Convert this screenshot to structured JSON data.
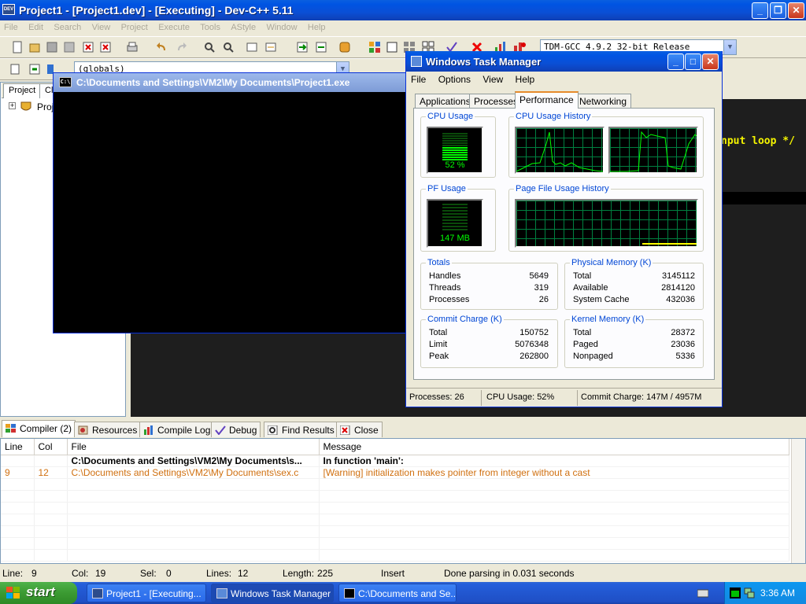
{
  "devcpp": {
    "title": "Project1 - [Project1.dev] - [Executing] - Dev-C++ 5.11",
    "menu": [
      "File",
      "Edit",
      "Search",
      "View",
      "Project",
      "Execute",
      "Tools",
      "AStyle",
      "Window",
      "Help"
    ],
    "compiler_combo": "TDM-GCC 4.9.2 32-bit Release",
    "globals_combo": "(globals)",
    "left_tabs": [
      "Project",
      "Cla"
    ],
    "tree_item": "Proj",
    "code_visible": "nput loop */",
    "bottom_tabs": [
      "Compiler (2)",
      "Resources",
      "Compile Log",
      "Debug",
      "Find Results",
      "Close"
    ],
    "messages": {
      "columns": [
        "Line",
        "Col",
        "File",
        "Message"
      ],
      "rows": [
        {
          "line": "",
          "col": "",
          "file": "C:\\Documents and Settings\\VM2\\My Documents\\s...",
          "message": "In function 'main':",
          "style": "bold"
        },
        {
          "line": "9",
          "col": "12",
          "file": "C:\\Documents and Settings\\VM2\\My Documents\\sex.c",
          "message": "[Warning] initialization makes pointer from integer without a cast",
          "style": "warn"
        }
      ]
    },
    "status": {
      "line_label": "Line:",
      "line": "9",
      "col_label": "Col:",
      "col": "19",
      "sel_label": "Sel:",
      "sel": "0",
      "lines_label": "Lines:",
      "lines": "12",
      "length_label": "Length:",
      "length": "225",
      "mode": "Insert",
      "message": "Done parsing in 0.031 seconds"
    }
  },
  "console": {
    "title": "C:\\Documents and Settings\\VM2\\My Documents\\Project1.exe",
    "icon_text": "C:\\"
  },
  "taskmgr": {
    "title": "Windows Task Manager",
    "menu": [
      "File",
      "Options",
      "View",
      "Help"
    ],
    "tabs": [
      "Applications",
      "Processes",
      "Performance",
      "Networking"
    ],
    "active_tab": "Performance",
    "cpu_usage_label": "CPU Usage",
    "cpu_usage_value": "52 %",
    "cpu_usage_fraction": 0.52,
    "cpu_history_label": "CPU Usage History",
    "pf_usage_label": "PF Usage",
    "pf_usage_value": "147 MB",
    "pf_history_label": "Page File Usage History",
    "totals": {
      "label": "Totals",
      "rows": [
        {
          "k": "Handles",
          "v": "5649"
        },
        {
          "k": "Threads",
          "v": "319"
        },
        {
          "k": "Processes",
          "v": "26"
        }
      ]
    },
    "physical": {
      "label": "Physical Memory (K)",
      "rows": [
        {
          "k": "Total",
          "v": "3145112"
        },
        {
          "k": "Available",
          "v": "2814120"
        },
        {
          "k": "System Cache",
          "v": "432036"
        }
      ]
    },
    "commit": {
      "label": "Commit Charge (K)",
      "rows": [
        {
          "k": "Total",
          "v": "150752"
        },
        {
          "k": "Limit",
          "v": "5076348"
        },
        {
          "k": "Peak",
          "v": "262800"
        }
      ]
    },
    "kernel": {
      "label": "Kernel Memory (K)",
      "rows": [
        {
          "k": "Total",
          "v": "28372"
        },
        {
          "k": "Paged",
          "v": "23036"
        },
        {
          "k": "Nonpaged",
          "v": "5336"
        }
      ]
    },
    "status": {
      "processes": "Processes: 26",
      "cpu": "CPU Usage: 52%",
      "commit": "Commit Charge: 147M / 4957M"
    }
  },
  "taskbar": {
    "start": "start",
    "buttons": [
      "Project1 - [Executing...",
      "Windows Task Manager",
      "C:\\Documents and Se..."
    ],
    "clock": "3:36 AM"
  },
  "colors": {
    "xp_blue": "#0054e3",
    "graph_green": "#00ff00",
    "warning_orange": "#d07010",
    "code_yellow": "#f5f500"
  }
}
